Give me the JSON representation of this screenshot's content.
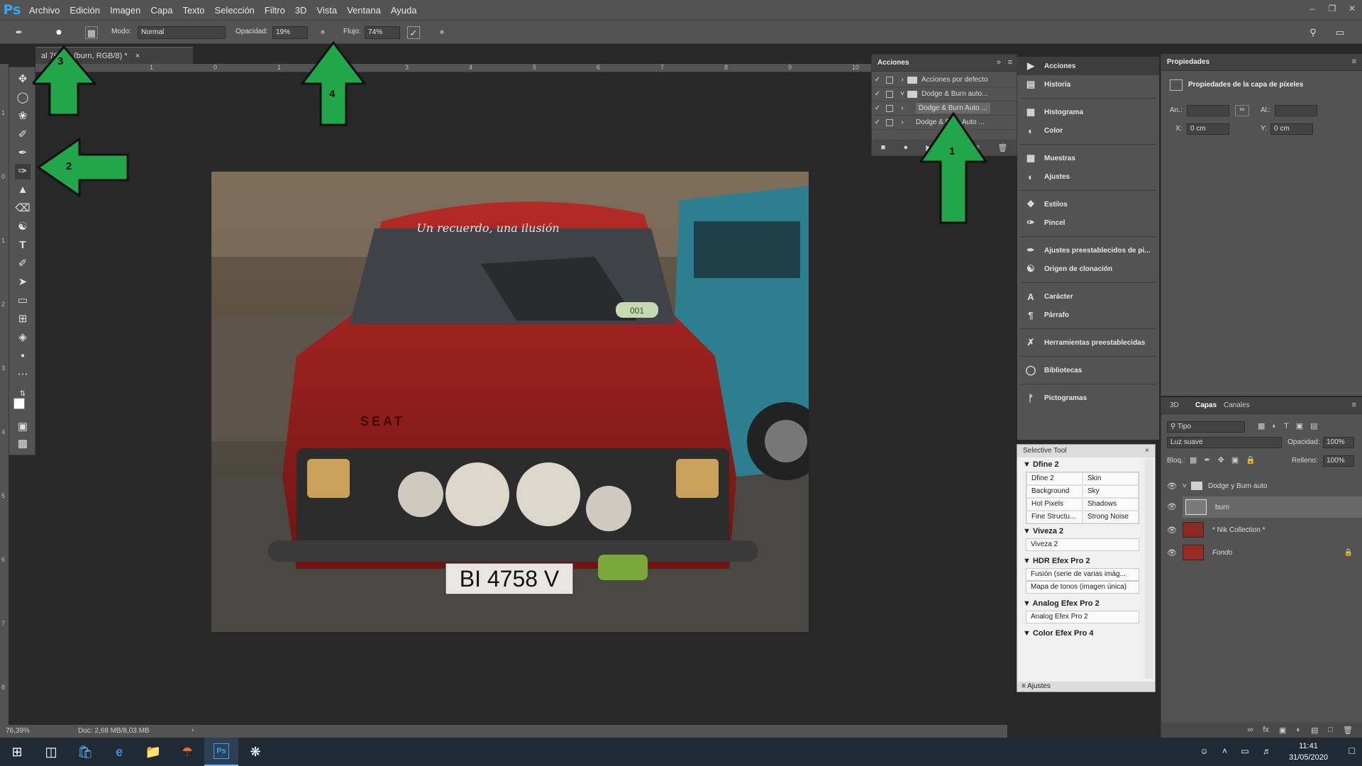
{
  "menubar": {
    "logo": "Ps",
    "items": [
      "Archivo",
      "Edición",
      "Imagen",
      "Capa",
      "Texto",
      "Selección",
      "Filtro",
      "3D",
      "Vista",
      "Ventana",
      "Ayuda"
    ]
  },
  "options": {
    "mode_label": "Modo:",
    "mode_value": "Normal",
    "opacity_label": "Opacidad:",
    "opacity_value": "19%",
    "flow_label": "Flujo:",
    "flow_value": "74%"
  },
  "doc_tab": {
    "title": "al 76,4% (burn, RGB/8) *"
  },
  "ruler": {
    "ticks": [
      "1",
      "0",
      "1",
      "2",
      "3",
      "4",
      "5",
      "6",
      "7",
      "8",
      "9",
      "10"
    ]
  },
  "ruler_v": {
    "ticks": [
      "1",
      "0",
      "1",
      "2",
      "3",
      "4",
      "5",
      "6",
      "7",
      "8"
    ]
  },
  "status": {
    "zoom": "76,39%",
    "doc": "Doc: 2,68 MB/8,03 MB"
  },
  "actions_panel": {
    "title": "Acciones",
    "rows": [
      {
        "label": "Acciones por defecto"
      },
      {
        "label": "Dodge & Burn auto..."
      },
      {
        "label": "Dodge & Burn Auto ..."
      },
      {
        "label": "Dodge & Burn Auto ..."
      }
    ]
  },
  "dock": {
    "items": [
      {
        "icon": "play-icon",
        "label": "Acciones"
      },
      {
        "icon": "history-icon",
        "label": "Historia"
      },
      {
        "icon": "histogram-icon",
        "label": "Histograma"
      },
      {
        "icon": "color-icon",
        "label": "Color"
      },
      {
        "icon": "swatches-icon",
        "label": "Muestras"
      },
      {
        "icon": "adjustments-icon",
        "label": "Ajustes"
      },
      {
        "icon": "styles-icon",
        "label": "Estilos"
      },
      {
        "icon": "brush-icon",
        "label": "Pincel"
      },
      {
        "icon": "brush-presets-icon",
        "label": "Ajustes preestablecidos de pi..."
      },
      {
        "icon": "clone-source-icon",
        "label": "Origen de clonación"
      },
      {
        "icon": "character-icon",
        "label": "Carácter"
      },
      {
        "icon": "paragraph-icon",
        "label": "Párrafo"
      },
      {
        "icon": "tool-presets-icon",
        "label": "Herramientas preestablecidas"
      },
      {
        "icon": "libraries-icon",
        "label": "Bibliotecas"
      },
      {
        "icon": "glyphs-icon",
        "label": "Pictogramas"
      }
    ]
  },
  "properties": {
    "title": "Propiedades",
    "subtitle": "Propiedades de la capa de píxeles",
    "w_label": "An.:",
    "h_label": "Al.:",
    "x_label": "X:",
    "x_value": "0 cm",
    "y_label": "Y:",
    "y_value": "0 cm"
  },
  "layers": {
    "tabs": [
      "3D",
      "Capas",
      "Canales"
    ],
    "filter": "Tipo",
    "blend": "Luz suave",
    "opacity_label": "Opacidad:",
    "opacity_value": "100%",
    "lock_label": "Bloq.:",
    "fill_label": "Relleno:",
    "fill_value": "100%",
    "rows": [
      {
        "label": "Dodge y Burn auto"
      },
      {
        "label": "burn"
      },
      {
        "label": "* Nik Collection *"
      },
      {
        "label": "Fondo"
      }
    ]
  },
  "selective_tool": {
    "title": "Selective Tool",
    "dfine_title": "Dfine 2",
    "dfine_items": [
      "Dfine 2",
      "Skin",
      "Background",
      "Sky",
      "Hot Pixels",
      "Shadows",
      "Fine Structu...",
      "Strong Noise"
    ],
    "viveza_title": "Viveza 2",
    "viveza_item": "Viveza 2",
    "hdr_title": "HDR Efex Pro 2",
    "hdr_items": [
      "Fusión (serie de varias imág...",
      "Mapa de tonos (imagen única)"
    ],
    "analog_title": "Analog Efex Pro 2",
    "analog_item": "Analog Efex Pro 2",
    "color_title": "Color Efex Pro 4",
    "footer": "Ajustes"
  },
  "photo": {
    "windshield_text": "Un recuerdo, una ilusión",
    "plate": "BI 4758 V",
    "brand": "SEAT",
    "sticker": "001"
  },
  "annotations": [
    "1",
    "2",
    "3",
    "4"
  ],
  "taskbar": {
    "time": "11:41",
    "date": "31/05/2020"
  },
  "colors": {
    "accent": "#31a8ff",
    "arrow": "#22a64a",
    "panel": "#535353"
  }
}
